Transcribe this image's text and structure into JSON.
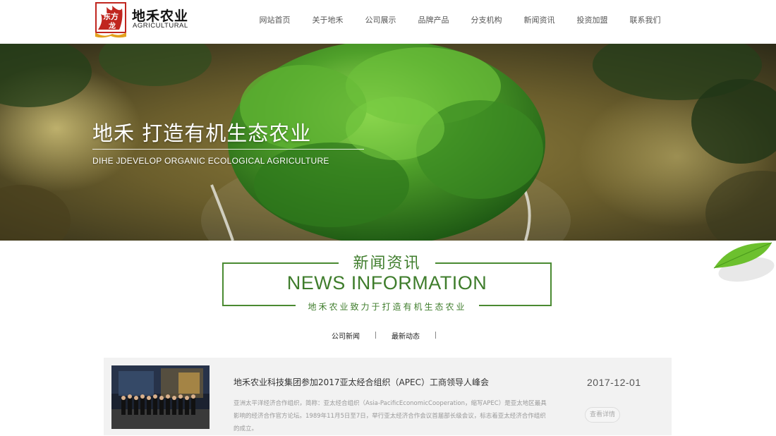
{
  "header": {
    "logo": {
      "seal_text": "东方龙",
      "name_cn": "地禾农业",
      "name_en": "AGRICULTURAL"
    },
    "nav": [
      {
        "label": "网站首页",
        "name": "nav-home"
      },
      {
        "label": "关于地禾",
        "name": "nav-about"
      },
      {
        "label": "公司展示",
        "name": "nav-company"
      },
      {
        "label": "品牌产品",
        "name": "nav-products"
      },
      {
        "label": "分支机构",
        "name": "nav-branches"
      },
      {
        "label": "新闻资讯",
        "name": "nav-news"
      },
      {
        "label": "投资加盟",
        "name": "nav-invest"
      },
      {
        "label": "联系我们",
        "name": "nav-contact"
      }
    ]
  },
  "banner": {
    "title": "地禾 打造有机生态农业",
    "subtitle": "DIHE JDEVELOP ORGANIC ECOLOGICAL AGRICULTURE"
  },
  "news_section": {
    "title_cn": "新闻资讯",
    "title_en": "NEWS INFORMATION",
    "slogan": "地禾农业致力于打造有机生态农业",
    "tabs": [
      "公司新闻",
      "最新动态"
    ],
    "items": [
      {
        "title": "地禾农业科技集团参加2017亚太经合组织（APEC）工商领导人峰会",
        "description": "亚洲太平洋经济合作组织，简称：亚太经合组织（Asia-PacificEconomicCooperation，缩写APEC）是亚太地区最具影响的经济合作官方论坛。1989年11月5日至7日，举行亚太经济合作会议首届部长级会议，标志着亚太经济合作组织的成立。",
        "date": "2017-12-01",
        "more_label": "查看详情"
      }
    ]
  },
  "colors": {
    "brand_green": "#3f7d2c",
    "card_bg": "#f2f2f2",
    "logo_red": "#c0261f"
  }
}
